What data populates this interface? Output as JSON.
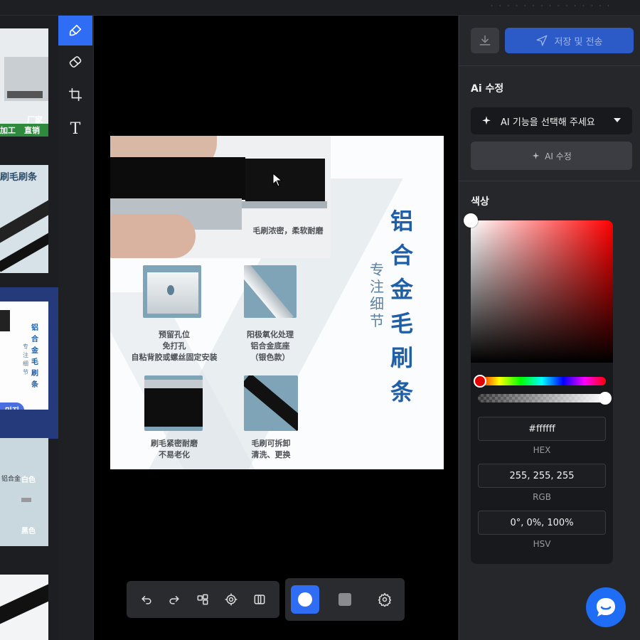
{
  "header": {
    "brand": ""
  },
  "sidebar_thumbs": {
    "thumb1_badge": [
      "加工",
      "厂家",
      "直销"
    ],
    "thumb2_title": "刷毛刷条",
    "thumb3_chars": [
      "铝",
      "合",
      "金",
      "毛",
      "刷",
      "条"
    ],
    "thumb3_sub": [
      "专",
      "注",
      "细",
      "节"
    ],
    "thumb3_badge": "미지",
    "thumb4_labels": [
      "铝合金",
      "白色",
      "黑色"
    ]
  },
  "tools": {
    "items": [
      {
        "name": "brush-tool",
        "icon": "brush-icon"
      },
      {
        "name": "eraser-tool",
        "icon": "eraser-icon"
      },
      {
        "name": "crop-tool",
        "icon": "crop-icon"
      },
      {
        "name": "text-tool",
        "icon": "text-icon",
        "glyph": "T"
      }
    ]
  },
  "right_panel": {
    "save_label": "저장 및 전송",
    "ai_section_title": "Ai 수정",
    "ai_select_label": "AI 기능을 선택해 주세요",
    "ai_button_label": "AI 수정",
    "color_section_title": "색상",
    "hex_value": "#ffffff",
    "hex_label": "HEX",
    "rgb_value": "255, 255, 255",
    "rgb_label": "RGB",
    "hsv_value": "0°, 0%, 100%",
    "hsv_label": "HSV"
  },
  "image": {
    "title_chars": [
      "铝",
      "合",
      "金",
      "毛",
      "刷",
      "条"
    ],
    "subtitle_chars": [
      "专",
      "注",
      "细",
      "节"
    ],
    "caption_top": "毛刷浓密，柔软耐磨",
    "caption_mid_left": [
      "预留孔位",
      "免打孔",
      "自粘背胶或螺丝固定安装"
    ],
    "caption_mid_right": [
      "阳极氧化处理",
      "铝合金底座",
      "（银色款）"
    ],
    "caption_bottom_left": [
      "刷毛紧密耐磨",
      "不易老化"
    ],
    "caption_bottom_right": [
      "毛刷可拆卸",
      "清洗、更换"
    ]
  },
  "colors": {
    "accent": "#2f6df5",
    "panel": "#26272b",
    "selected_color": "#ffffff",
    "hue": "#ff0000"
  }
}
